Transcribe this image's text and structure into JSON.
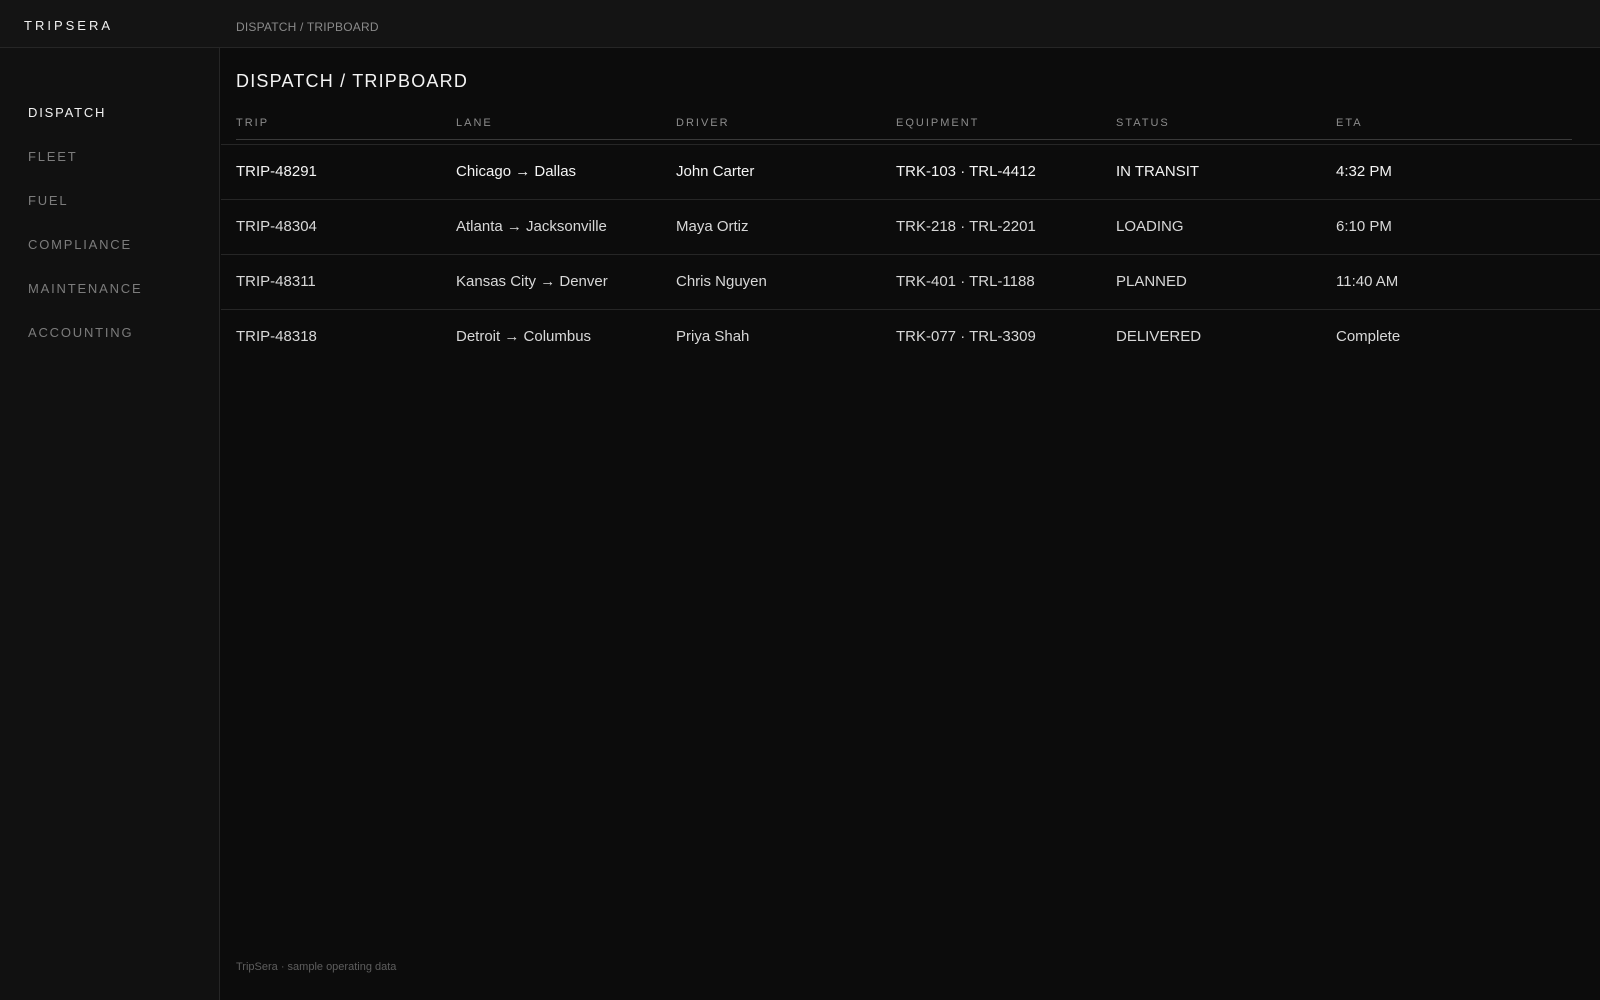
{
  "app": {
    "brand": "TRIPSERA",
    "breadcrumb": "DISPATCH / TRIPBOARD"
  },
  "sidebar": {
    "items": [
      {
        "label": "DISPATCH",
        "active": true
      },
      {
        "label": "FLEET",
        "active": false
      },
      {
        "label": "FUEL",
        "active": false
      },
      {
        "label": "COMPLIANCE",
        "active": false
      },
      {
        "label": "MAINTENANCE",
        "active": false
      },
      {
        "label": "ACCOUNTING",
        "active": false
      }
    ]
  },
  "main": {
    "title": "DISPATCH / TRIPBOARD",
    "table": {
      "columns": [
        "TRIP",
        "LANE",
        "DRIVER",
        "EQUIPMENT",
        "STATUS",
        "ETA"
      ],
      "rows": [
        [
          "TRIP-48291",
          "Chicago → Dallas",
          "John Carter",
          "TRK-103 · TRL-4412",
          "IN TRANSIT",
          "4:32 PM"
        ],
        [
          "TRIP-48304",
          "Atlanta → Jacksonville",
          "Maya Ortiz",
          "TRK-218 · TRL-2201",
          "LOADING",
          "6:10 PM"
        ],
        [
          "TRIP-48311",
          "Kansas City → Denver",
          "Chris Nguyen",
          "TRK-401 · TRL-1188",
          "PLANNED",
          "11:40 AM"
        ],
        [
          "TRIP-48318",
          "Detroit → Columbus",
          "Priya Shah",
          "TRK-077 · TRL-3309",
          "DELIVERED",
          "Complete"
        ]
      ]
    },
    "footer": "TripSera · sample operating data"
  },
  "colors": {
    "background": "#0c0c0c",
    "sidebar": "#111111",
    "topbar": "#141414",
    "text": "#e8e8e8",
    "muted": "#8a8a8a"
  }
}
